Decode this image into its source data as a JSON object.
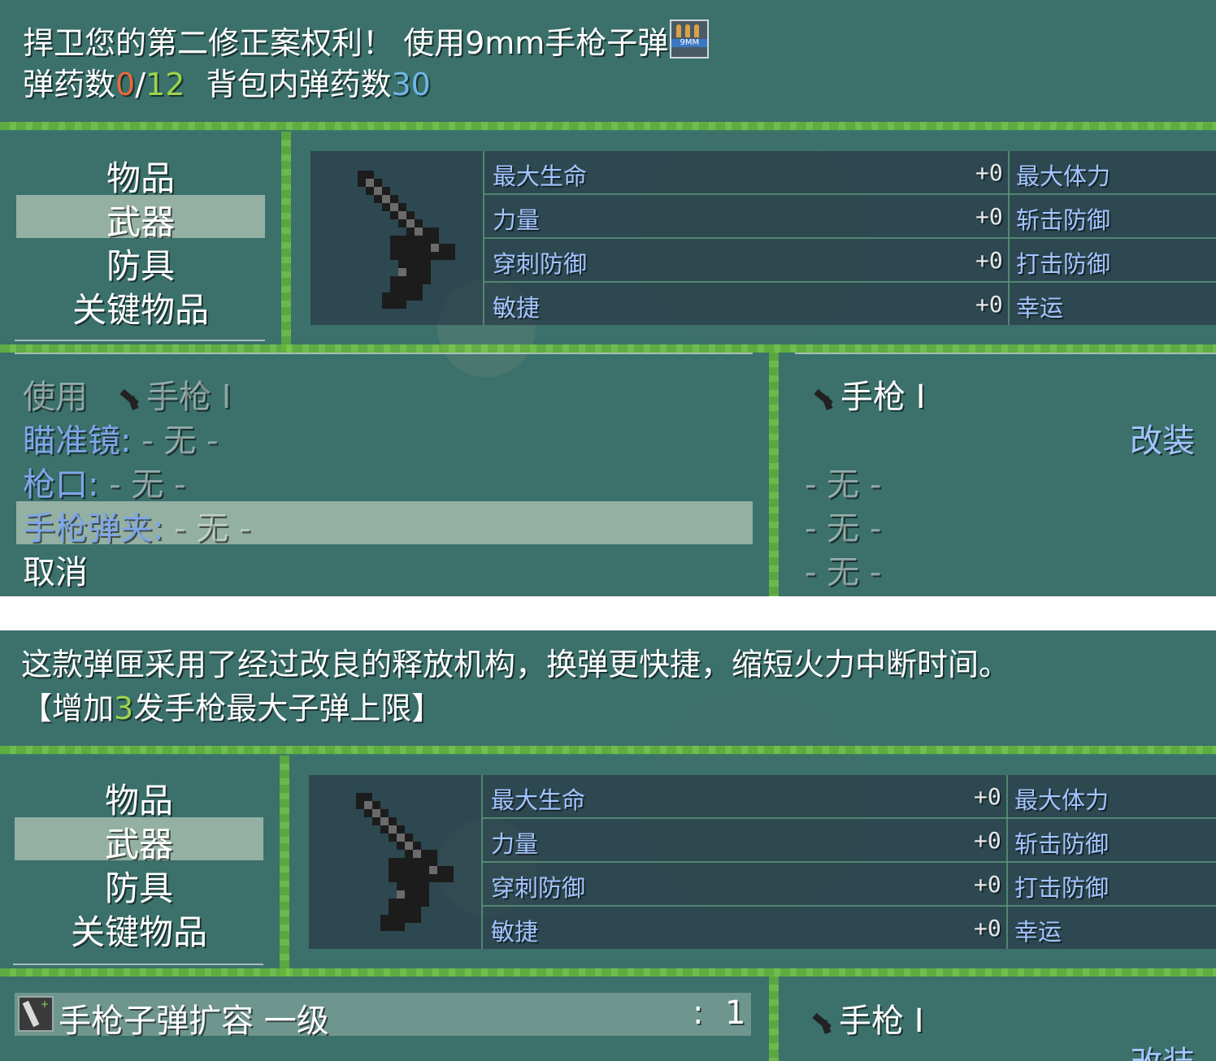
{
  "top": {
    "help": {
      "line1_a": "捍卫您的第二修正案权利！ 使用9mm手枪子弹",
      "ammo_badge": "9MM",
      "line2_label": "弹药数",
      "ammo_current": "0",
      "ammo_sep": "/",
      "ammo_max": "12",
      "bag_label": "背包内弹药数",
      "bag_count": "30"
    },
    "categories": [
      "物品",
      "武器",
      "防具",
      "关键物品"
    ],
    "selected_category": "武器",
    "stats": [
      {
        "label": "最大生命",
        "value": "+0",
        "right_label": "最大体力"
      },
      {
        "label": "力量",
        "value": "+0",
        "right_label": "斩击防御"
      },
      {
        "label": "穿刺防御",
        "value": "+0",
        "right_label": "打击防御"
      },
      {
        "label": "敏捷",
        "value": "+0",
        "right_label": "幸运"
      }
    ],
    "slots": {
      "use_label": "使用",
      "weapon_name": "手枪 I",
      "scope_label": "瞄准镜:",
      "scope_value": "- 无 -",
      "muzzle_label": "枪口:",
      "muzzle_value": "- 无 -",
      "mag_label": "手枪弹夹:",
      "mag_value": "- 无 -",
      "cancel": "取消"
    },
    "right_panel": {
      "weapon_name": "手枪 I",
      "modify": "改装",
      "entries": [
        "- 无 -",
        "- 无 -",
        "- 无 -"
      ]
    }
  },
  "bottom": {
    "help": {
      "line1": "这款弹匣采用了经过改良的释放机构，换弹更快捷，缩短火力中断时间。",
      "line2_a": "【增加",
      "line2_num": "3",
      "line2_b": "发手枪最大子弹上限】"
    },
    "categories": [
      "物品",
      "武器",
      "防具",
      "关键物品"
    ],
    "selected_category": "武器",
    "stats": [
      {
        "label": "最大生命",
        "value": "+0",
        "right_label": "最大体力"
      },
      {
        "label": "力量",
        "value": "+0",
        "right_label": "斩击防御"
      },
      {
        "label": "穿刺防御",
        "value": "+0",
        "right_label": "打击防御"
      },
      {
        "label": "敏捷",
        "value": "+0",
        "right_label": "幸运"
      }
    ],
    "item_row": {
      "name": "手枪子弹扩容 一级",
      "count_sep": ":",
      "count": "1"
    },
    "right_panel": {
      "weapon_name": "手枪 I",
      "modify": "改装"
    }
  },
  "colors": {
    "ammo_empty": "#e86a3c",
    "ammo_max": "#9ad44e",
    "bag_count": "#6fb6e6",
    "stat_label": "#a3c4ff",
    "slot_label": "#7fa6e8"
  },
  "icons": [
    "pistol-icon",
    "ammo-9mm-icon",
    "magazine-icon"
  ]
}
